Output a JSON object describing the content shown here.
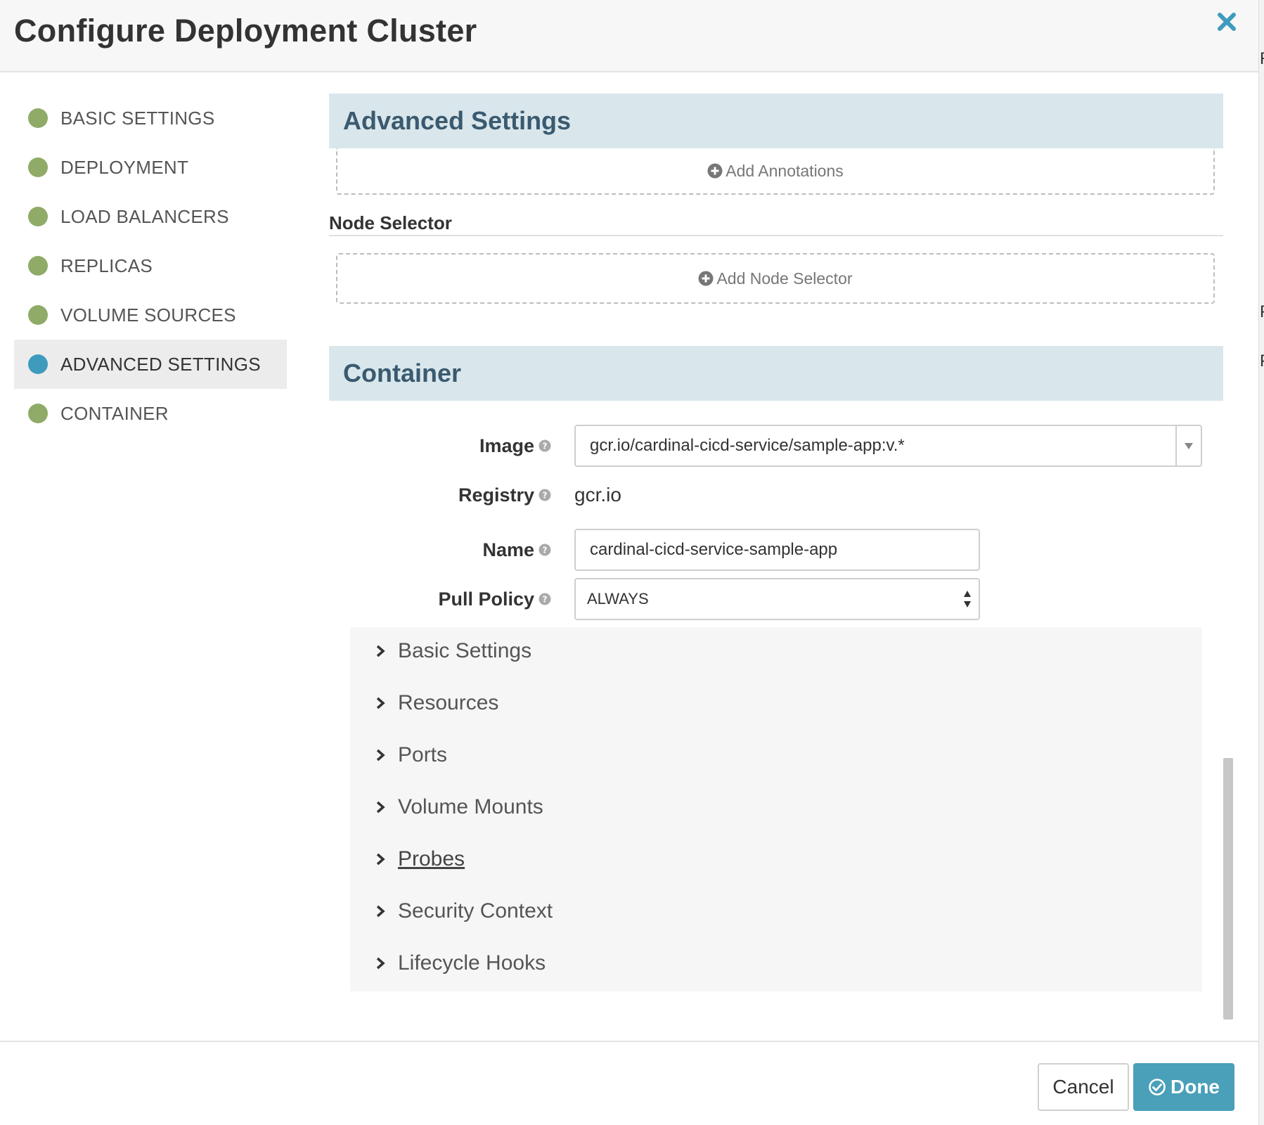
{
  "dialog": {
    "title": "Configure Deployment Cluster"
  },
  "backdrop": {
    "chars": [
      "R",
      "Pr",
      "P"
    ]
  },
  "colors": {
    "accent": "#4a9fb9",
    "nav_done": "#8fab67",
    "nav_active": "#3f9bbd",
    "section_bg": "#d9e7ec"
  },
  "sidebar": {
    "items": [
      {
        "label": "BASIC SETTINGS",
        "active": false
      },
      {
        "label": "DEPLOYMENT",
        "active": false
      },
      {
        "label": "LOAD BALANCERS",
        "active": false
      },
      {
        "label": "REPLICAS",
        "active": false
      },
      {
        "label": "VOLUME SOURCES",
        "active": false
      },
      {
        "label": "ADVANCED SETTINGS",
        "active": true
      },
      {
        "label": "CONTAINER",
        "active": false
      }
    ]
  },
  "advanced": {
    "heading": "Advanced Settings",
    "add_annotations": "Add Annotations",
    "node_selector_title": "Node Selector",
    "add_node_selector": "Add Node Selector"
  },
  "container": {
    "heading": "Container",
    "image": {
      "label": "Image",
      "value": "gcr.io/cardinal-cicd-service/sample-app:v.*"
    },
    "registry": {
      "label": "Registry",
      "value": "gcr.io"
    },
    "name": {
      "label": "Name",
      "value": "cardinal-cicd-service-sample-app"
    },
    "pull_policy": {
      "label": "Pull Policy",
      "value": "ALWAYS"
    },
    "sections": [
      {
        "label": "Basic Settings"
      },
      {
        "label": "Resources"
      },
      {
        "label": "Ports"
      },
      {
        "label": "Volume Mounts"
      },
      {
        "label": "Probes"
      },
      {
        "label": "Security Context"
      },
      {
        "label": "Lifecycle Hooks"
      }
    ]
  },
  "footer": {
    "cancel_label": "Cancel",
    "done_label": "Done"
  }
}
